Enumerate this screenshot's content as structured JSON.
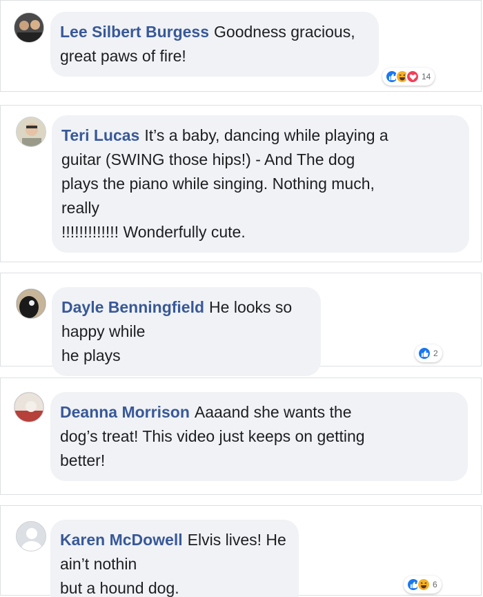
{
  "comments": [
    {
      "author": "Lee Silbert Burgess",
      "text": "Goodness gracious,\ngreat paws of fire!",
      "reactions": {
        "icons": [
          "like-icon",
          "haha-icon",
          "love-icon"
        ],
        "count": "14"
      }
    },
    {
      "author": "Teri Lucas",
      "text": "It’s a baby, dancing while playing a\nguitar (SWING those hips!) - And The dog\nplays the piano while singing. Nothing much,\nreally\n!!!!!!!!!!!!! Wonderfully cute."
    },
    {
      "author": "Dayle Benningfield",
      "text": "He looks so happy while\nhe plays",
      "reactions": {
        "icons": [
          "like-icon"
        ],
        "count": "2"
      }
    },
    {
      "author": "Deanna Morrison",
      "text": "Aaaand she wants the\ndog’s treat! This video just keeps on getting\nbetter!"
    },
    {
      "author": "Karen McDowell",
      "text": "Elvis lives! He ain’t nothin\nbut a hound dog.",
      "reactions": {
        "icons": [
          "like-icon",
          "haha-icon"
        ],
        "count": "6"
      }
    }
  ],
  "colors": {
    "author": "#385898",
    "bubble": "#f0f2f5",
    "like": "#1877f2",
    "haha": "#f7b125",
    "love": "#f33e58"
  }
}
